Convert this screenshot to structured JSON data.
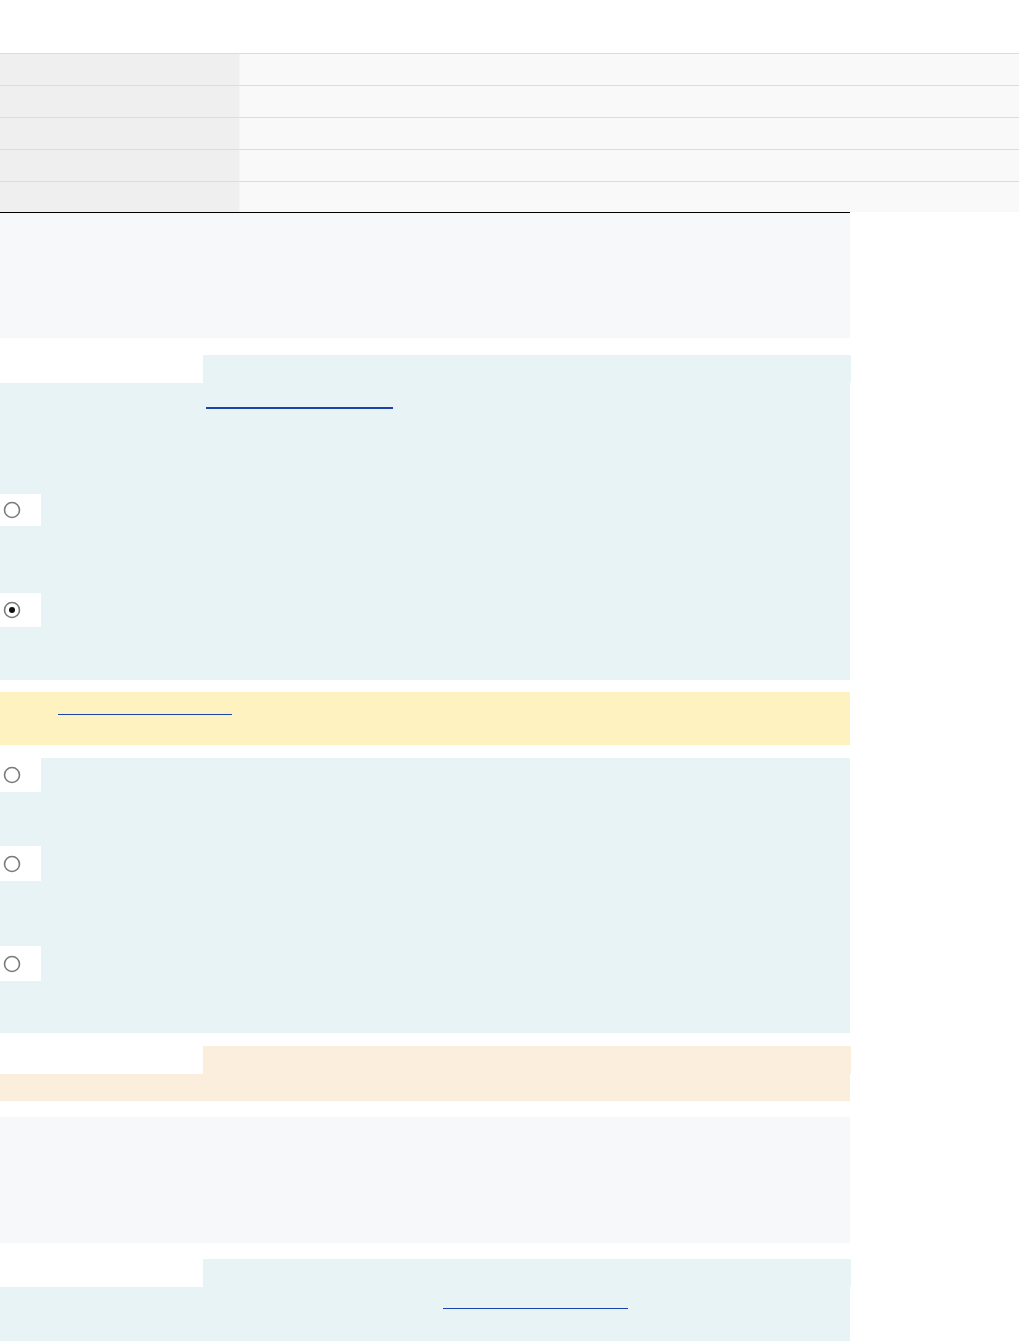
{
  "questions": [
    {
      "options": [
        {
          "selected": false
        },
        {
          "selected": true
        }
      ]
    },
    {
      "options": [
        {
          "selected": false
        },
        {
          "selected": false
        },
        {
          "selected": false
        }
      ]
    }
  ]
}
